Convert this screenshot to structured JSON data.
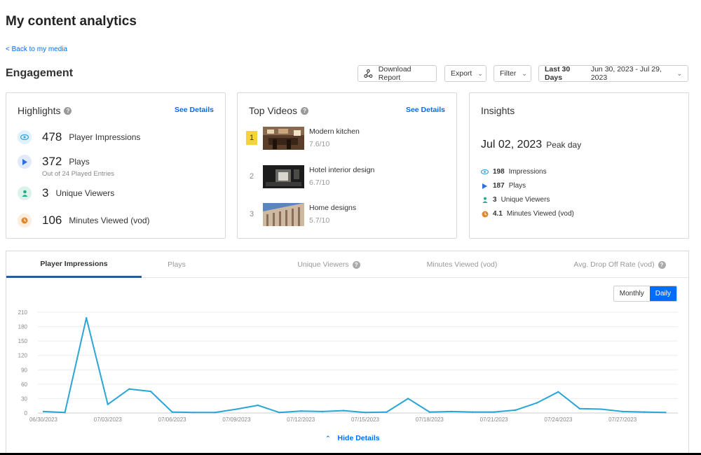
{
  "page": {
    "title": "My content analytics",
    "back_link": "< Back to my media",
    "section_title": "Engagement"
  },
  "toolbar": {
    "download_label": "Download Report",
    "export_label": "Export",
    "filter_label": "Filter",
    "date_preset": "Last 30 Days",
    "date_range": "Jun 30, 2023 - Jul 29, 2023"
  },
  "highlights": {
    "title": "Highlights",
    "see_details": "See Details",
    "items": [
      {
        "value": "478",
        "label": "Player Impressions",
        "icon": "eye-icon",
        "color": "#3aa6dd",
        "bg": "#dff1fb"
      },
      {
        "value": "372",
        "label": "Plays",
        "icon": "play-icon",
        "color": "#2f6fd8",
        "bg": "#e0eafa"
      },
      {
        "value": "3",
        "label": "Unique Viewers",
        "icon": "user-icon",
        "color": "#2ea888",
        "bg": "#dcf3ec"
      },
      {
        "value": "106",
        "label": "Minutes Viewed (vod)",
        "icon": "clock-icon",
        "color": "#e0892c",
        "bg": "#fbeedd"
      }
    ],
    "plays_sub": "Out of 24 Played Entries"
  },
  "top_videos": {
    "title": "Top Videos",
    "see_details": "See Details",
    "items": [
      {
        "rank": "1",
        "name": "Modern kitchen",
        "score": "7.6/10"
      },
      {
        "rank": "2",
        "name": "Hotel interior design",
        "score": "6.7/10"
      },
      {
        "rank": "3",
        "name": "Home designs",
        "score": "5.7/10"
      }
    ]
  },
  "insights": {
    "title": "Insights",
    "peak_date": "Jul 02, 2023",
    "peak_label": "Peak day",
    "items": [
      {
        "value": "198",
        "label": "Impressions",
        "icon": "eye-icon"
      },
      {
        "value": "187",
        "label": "Plays",
        "icon": "play-icon"
      },
      {
        "value": "3",
        "label": "Unique Viewers",
        "icon": "user-icon"
      },
      {
        "value": "4.1",
        "label": "Minutes Viewed (vod)",
        "icon": "clock-icon"
      }
    ]
  },
  "tabs": [
    {
      "label": "Player Impressions",
      "help": false
    },
    {
      "label": "Plays",
      "help": false
    },
    {
      "label": "Unique Viewers",
      "help": true
    },
    {
      "label": "Minutes Viewed (vod)",
      "help": false
    },
    {
      "label": "Avg. Drop Off Rate (vod)",
      "help": true
    }
  ],
  "toggle": {
    "monthly": "Monthly",
    "daily": "Daily"
  },
  "hide_details": "Hide Details",
  "colors": {
    "accent": "#006efa",
    "line": "#2aa6d6",
    "tab_indicator": "#2d5b9a"
  },
  "chart_data": {
    "type": "line",
    "ylim": [
      0,
      210
    ],
    "yticks": [
      "0",
      "30",
      "60",
      "90",
      "120",
      "150",
      "180",
      "210"
    ],
    "xtick_labels": [
      "06/30/2023",
      "07/03/2023",
      "07/06/2023",
      "07/09/2023",
      "07/12/2023",
      "07/15/2023",
      "07/18/2023",
      "07/21/2023",
      "07/24/2023",
      "07/27/2023"
    ],
    "x": [
      "06/30/2023",
      "07/01/2023",
      "07/02/2023",
      "07/03/2023",
      "07/04/2023",
      "07/05/2023",
      "07/06/2023",
      "07/07/2023",
      "07/08/2023",
      "07/09/2023",
      "07/10/2023",
      "07/11/2023",
      "07/12/2023",
      "07/13/2023",
      "07/14/2023",
      "07/15/2023",
      "07/16/2023",
      "07/17/2023",
      "07/18/2023",
      "07/19/2023",
      "07/20/2023",
      "07/21/2023",
      "07/22/2023",
      "07/23/2023",
      "07/24/2023",
      "07/25/2023",
      "07/26/2023",
      "07/27/2023",
      "07/28/2023",
      "07/29/2023"
    ],
    "series": [
      {
        "values": [
          3,
          1,
          198,
          18,
          50,
          45,
          2,
          1,
          1,
          8,
          16,
          1,
          4,
          3,
          5,
          1,
          2,
          30,
          2,
          3,
          2,
          2,
          6,
          21,
          44,
          9,
          8,
          3,
          2,
          1
        ]
      }
    ],
    "grid": true
  }
}
